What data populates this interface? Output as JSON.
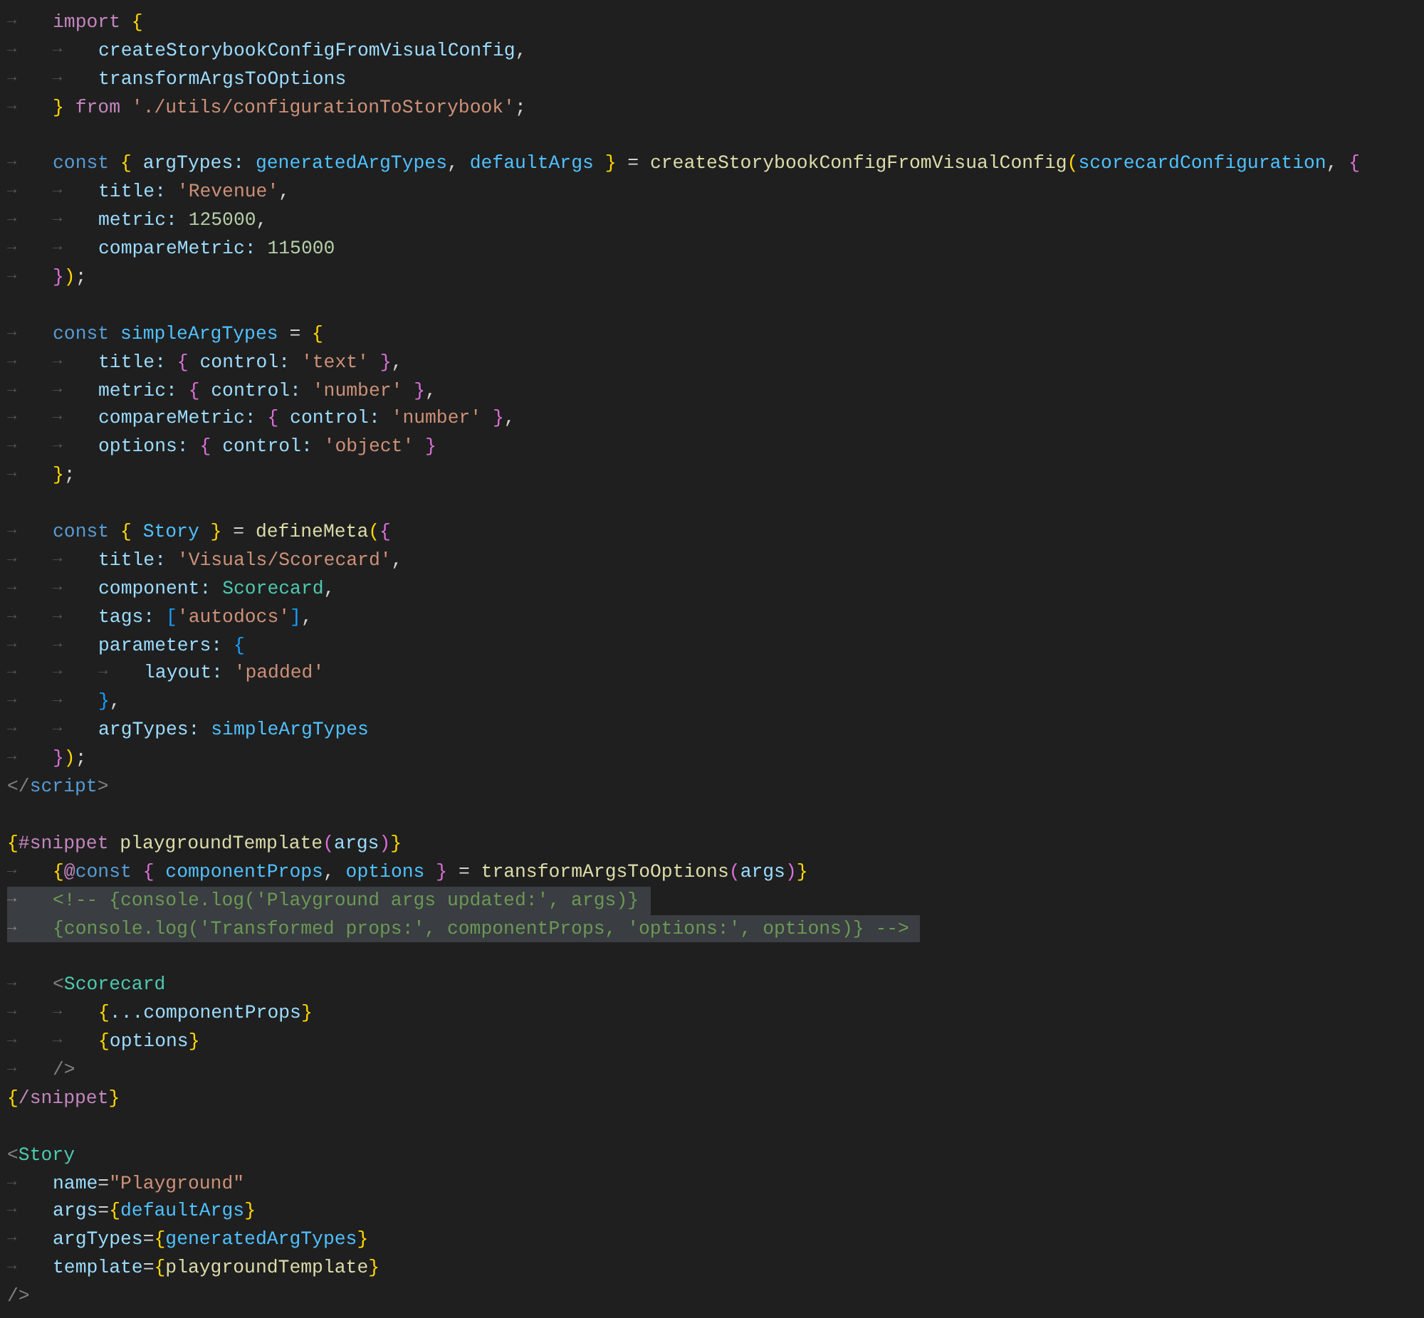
{
  "editor": {
    "lines": [
      {
        "tabs": [
          "→"
        ],
        "highlighted": false,
        "tokens": [
          {
            "text": "import",
            "color": "#c586c0"
          },
          {
            "text": " {",
            "color": "#ffd700"
          }
        ]
      },
      {
        "tabs": [
          "→",
          "→"
        ],
        "highlighted": false,
        "tokens": [
          {
            "text": "createStorybookConfigFromVisualConfig",
            "color": "#9cdcfe"
          },
          {
            "text": ",",
            "color": "#d4d4d4"
          }
        ]
      },
      {
        "tabs": [
          "→",
          "→"
        ],
        "highlighted": false,
        "tokens": [
          {
            "text": "transformArgsToOptions",
            "color": "#9cdcfe"
          }
        ]
      },
      {
        "tabs": [
          "→"
        ],
        "highlighted": false,
        "tokens": [
          {
            "text": "}",
            "color": "#ffd700"
          },
          {
            "text": " from ",
            "color": "#c586c0"
          },
          {
            "text": "'./utils/configurationToStorybook'",
            "color": "#ce9178"
          },
          {
            "text": ";",
            "color": "#d4d4d4"
          }
        ]
      },
      {
        "highlighted": false
      },
      {
        "tabs": [
          "→"
        ],
        "highlighted": false,
        "tokens": [
          {
            "text": "const",
            "color": "#569cd6"
          },
          {
            "text": " {",
            "color": "#ffd700"
          },
          {
            "text": " argTypes: ",
            "color": "#9cdcfe"
          },
          {
            "text": "generatedArgTypes",
            "color": "#4fc1ff"
          },
          {
            "text": ", ",
            "color": "#d4d4d4"
          },
          {
            "text": "defaultArgs",
            "color": "#4fc1ff"
          },
          {
            "text": " }",
            "color": "#ffd700"
          },
          {
            "text": " = ",
            "color": "#d4d4d4"
          },
          {
            "text": "createStorybookConfigFromVisualConfig",
            "color": "#dcdcaa"
          },
          {
            "text": "(",
            "color": "#ffd700"
          },
          {
            "text": "scorecardConfiguration",
            "color": "#4fc1ff"
          },
          {
            "text": ", ",
            "color": "#d4d4d4"
          },
          {
            "text": "{",
            "color": "#da70d6"
          }
        ]
      },
      {
        "tabs": [
          "→",
          "→"
        ],
        "highlighted": false,
        "tokens": [
          {
            "text": "title: ",
            "color": "#9cdcfe"
          },
          {
            "text": "'Revenue'",
            "color": "#ce9178"
          },
          {
            "text": ",",
            "color": "#d4d4d4"
          }
        ]
      },
      {
        "tabs": [
          "→",
          "→"
        ],
        "highlighted": false,
        "tokens": [
          {
            "text": "metric: ",
            "color": "#9cdcfe"
          },
          {
            "text": "125000",
            "color": "#b5cea8"
          },
          {
            "text": ",",
            "color": "#d4d4d4"
          }
        ]
      },
      {
        "tabs": [
          "→",
          "→"
        ],
        "highlighted": false,
        "tokens": [
          {
            "text": "compareMetric: ",
            "color": "#9cdcfe"
          },
          {
            "text": "115000",
            "color": "#b5cea8"
          }
        ]
      },
      {
        "tabs": [
          "→"
        ],
        "highlighted": false,
        "tokens": [
          {
            "text": "}",
            "color": "#da70d6"
          },
          {
            "text": ")",
            "color": "#ffd700"
          },
          {
            "text": ";",
            "color": "#d4d4d4"
          }
        ]
      },
      {
        "highlighted": false
      },
      {
        "tabs": [
          "→"
        ],
        "highlighted": false,
        "tokens": [
          {
            "text": "const",
            "color": "#569cd6"
          },
          {
            "text": " simpleArgTypes",
            "color": "#4fc1ff"
          },
          {
            "text": " = ",
            "color": "#d4d4d4"
          },
          {
            "text": "{",
            "color": "#ffd700"
          }
        ]
      },
      {
        "tabs": [
          "→",
          "→"
        ],
        "highlighted": false,
        "tokens": [
          {
            "text": "title: ",
            "color": "#9cdcfe"
          },
          {
            "text": "{",
            "color": "#da70d6"
          },
          {
            "text": " control: ",
            "color": "#9cdcfe"
          },
          {
            "text": "'text'",
            "color": "#ce9178"
          },
          {
            "text": " }",
            "color": "#da70d6"
          },
          {
            "text": ",",
            "color": "#d4d4d4"
          }
        ]
      },
      {
        "tabs": [
          "→",
          "→"
        ],
        "highlighted": false,
        "tokens": [
          {
            "text": "metric: ",
            "color": "#9cdcfe"
          },
          {
            "text": "{",
            "color": "#da70d6"
          },
          {
            "text": " control: ",
            "color": "#9cdcfe"
          },
          {
            "text": "'number'",
            "color": "#ce9178"
          },
          {
            "text": " }",
            "color": "#da70d6"
          },
          {
            "text": ",",
            "color": "#d4d4d4"
          }
        ]
      },
      {
        "tabs": [
          "→",
          "→"
        ],
        "highlighted": false,
        "tokens": [
          {
            "text": "compareMetric: ",
            "color": "#9cdcfe"
          },
          {
            "text": "{",
            "color": "#da70d6"
          },
          {
            "text": " control: ",
            "color": "#9cdcfe"
          },
          {
            "text": "'number'",
            "color": "#ce9178"
          },
          {
            "text": " }",
            "color": "#da70d6"
          },
          {
            "text": ",",
            "color": "#d4d4d4"
          }
        ]
      },
      {
        "tabs": [
          "→",
          "→"
        ],
        "highlighted": false,
        "tokens": [
          {
            "text": "options: ",
            "color": "#9cdcfe"
          },
          {
            "text": "{",
            "color": "#da70d6"
          },
          {
            "text": " control: ",
            "color": "#9cdcfe"
          },
          {
            "text": "'object'",
            "color": "#ce9178"
          },
          {
            "text": " }",
            "color": "#da70d6"
          }
        ]
      },
      {
        "tabs": [
          "→"
        ],
        "highlighted": false,
        "tokens": [
          {
            "text": "}",
            "color": "#ffd700"
          },
          {
            "text": ";",
            "color": "#d4d4d4"
          }
        ]
      },
      {
        "highlighted": false
      },
      {
        "tabs": [
          "→"
        ],
        "highlighted": false,
        "tokens": [
          {
            "text": "const",
            "color": "#569cd6"
          },
          {
            "text": " {",
            "color": "#ffd700"
          },
          {
            "text": " Story",
            "color": "#4fc1ff"
          },
          {
            "text": " }",
            "color": "#ffd700"
          },
          {
            "text": " = ",
            "color": "#d4d4d4"
          },
          {
            "text": "defineMeta",
            "color": "#dcdcaa"
          },
          {
            "text": "(",
            "color": "#ffd700"
          },
          {
            "text": "{",
            "color": "#da70d6"
          }
        ]
      },
      {
        "tabs": [
          "→",
          "→"
        ],
        "highlighted": false,
        "tokens": [
          {
            "text": "title: ",
            "color": "#9cdcfe"
          },
          {
            "text": "'Visuals/Scorecard'",
            "color": "#ce9178"
          },
          {
            "text": ",",
            "color": "#d4d4d4"
          }
        ]
      },
      {
        "tabs": [
          "→",
          "→"
        ],
        "highlighted": false,
        "tokens": [
          {
            "text": "component: ",
            "color": "#9cdcfe"
          },
          {
            "text": "Scorecard",
            "color": "#4ec9b0"
          },
          {
            "text": ",",
            "color": "#d4d4d4"
          }
        ]
      },
      {
        "tabs": [
          "→",
          "→"
        ],
        "highlighted": false,
        "tokens": [
          {
            "text": "tags: ",
            "color": "#9cdcfe"
          },
          {
            "text": "[",
            "color": "#179fff"
          },
          {
            "text": "'autodocs'",
            "color": "#ce9178"
          },
          {
            "text": "]",
            "color": "#179fff"
          },
          {
            "text": ",",
            "color": "#d4d4d4"
          }
        ]
      },
      {
        "tabs": [
          "→",
          "→"
        ],
        "highlighted": false,
        "tokens": [
          {
            "text": "parameters: ",
            "color": "#9cdcfe"
          },
          {
            "text": "{",
            "color": "#179fff"
          }
        ]
      },
      {
        "tabs": [
          "→",
          "→",
          "→"
        ],
        "highlighted": false,
        "tokens": [
          {
            "text": "layout: ",
            "color": "#9cdcfe"
          },
          {
            "text": "'padded'",
            "color": "#ce9178"
          }
        ]
      },
      {
        "tabs": [
          "→",
          "→"
        ],
        "highlighted": false,
        "tokens": [
          {
            "text": "}",
            "color": "#179fff"
          },
          {
            "text": ",",
            "color": "#d4d4d4"
          }
        ]
      },
      {
        "tabs": [
          "→",
          "→"
        ],
        "highlighted": false,
        "tokens": [
          {
            "text": "argTypes: ",
            "color": "#9cdcfe"
          },
          {
            "text": "simpleArgTypes",
            "color": "#4fc1ff"
          }
        ]
      },
      {
        "tabs": [
          "→"
        ],
        "highlighted": false,
        "tokens": [
          {
            "text": "}",
            "color": "#da70d6"
          },
          {
            "text": ")",
            "color": "#ffd700"
          },
          {
            "text": ";",
            "color": "#d4d4d4"
          }
        ]
      },
      {
        "highlighted": false,
        "tokens": [
          {
            "text": "</",
            "color": "#808080"
          },
          {
            "text": "script",
            "color": "#569cd6"
          },
          {
            "text": ">",
            "color": "#808080"
          }
        ]
      },
      {
        "highlighted": false
      },
      {
        "highlighted": false,
        "tokens": [
          {
            "text": "{",
            "color": "#ffd700"
          },
          {
            "text": "#snippet",
            "color": "#c586c0"
          },
          {
            "text": " playgroundTemplate",
            "color": "#dcdcaa"
          },
          {
            "text": "(",
            "color": "#da70d6"
          },
          {
            "text": "args",
            "color": "#9cdcfe"
          },
          {
            "text": ")",
            "color": "#da70d6"
          },
          {
            "text": "}",
            "color": "#ffd700"
          }
        ]
      },
      {
        "tabs": [
          "→"
        ],
        "highlighted": false,
        "tokens": [
          {
            "text": "{",
            "color": "#ffd700"
          },
          {
            "text": "@",
            "color": "#c586c0"
          },
          {
            "text": "const",
            "color": "#569cd6"
          },
          {
            "text": " {",
            "color": "#da70d6"
          },
          {
            "text": " componentProps",
            "color": "#4fc1ff"
          },
          {
            "text": ", ",
            "color": "#d4d4d4"
          },
          {
            "text": "options",
            "color": "#4fc1ff"
          },
          {
            "text": " }",
            "color": "#da70d6"
          },
          {
            "text": " = ",
            "color": "#d4d4d4"
          },
          {
            "text": "transformArgsToOptions",
            "color": "#dcdcaa"
          },
          {
            "text": "(",
            "color": "#da70d6"
          },
          {
            "text": "args",
            "color": "#9cdcfe"
          },
          {
            "text": ")",
            "color": "#da70d6"
          },
          {
            "text": "}",
            "color": "#ffd700"
          }
        ]
      },
      {
        "tabs": [
          "→"
        ],
        "highlighted": true,
        "tokens": [
          {
            "text": "<!-- {console.log('Playground args updated:', args)}",
            "color": "#6a9955"
          }
        ]
      },
      {
        "tabs": [
          "→"
        ],
        "highlighted": true,
        "tokens": [
          {
            "text": "{console.log('Transformed props:', componentProps, 'options:', options)} -->",
            "color": "#6a9955"
          }
        ]
      },
      {
        "highlighted": false
      },
      {
        "tabs": [
          "→"
        ],
        "highlighted": false,
        "tokens": [
          {
            "text": "<",
            "color": "#808080"
          },
          {
            "text": "Scorecard",
            "color": "#4ec9b0"
          }
        ]
      },
      {
        "tabs": [
          "→",
          "→"
        ],
        "highlighted": false,
        "tokens": [
          {
            "text": "{",
            "color": "#ffd700"
          },
          {
            "text": "...componentProps",
            "color": "#9cdcfe"
          },
          {
            "text": "}",
            "color": "#ffd700"
          }
        ]
      },
      {
        "tabs": [
          "→",
          "→"
        ],
        "highlighted": false,
        "tokens": [
          {
            "text": "{",
            "color": "#ffd700"
          },
          {
            "text": "options",
            "color": "#9cdcfe"
          },
          {
            "text": "}",
            "color": "#ffd700"
          }
        ]
      },
      {
        "tabs": [
          "→"
        ],
        "highlighted": false,
        "tokens": [
          {
            "text": "/>",
            "color": "#808080"
          }
        ]
      },
      {
        "highlighted": false,
        "tokens": [
          {
            "text": "{",
            "color": "#ffd700"
          },
          {
            "text": "/snippet",
            "color": "#c586c0"
          },
          {
            "text": "}",
            "color": "#ffd700"
          }
        ]
      },
      {
        "highlighted": false
      },
      {
        "highlighted": false,
        "tokens": [
          {
            "text": "<",
            "color": "#808080"
          },
          {
            "text": "Story",
            "color": "#4ec9b0"
          }
        ]
      },
      {
        "tabs": [
          "→"
        ],
        "highlighted": false,
        "tokens": [
          {
            "text": "name",
            "color": "#9cdcfe"
          },
          {
            "text": "=",
            "color": "#d4d4d4"
          },
          {
            "text": "\"Playground\"",
            "color": "#ce9178"
          }
        ]
      },
      {
        "tabs": [
          "→"
        ],
        "highlighted": false,
        "tokens": [
          {
            "text": "args",
            "color": "#9cdcfe"
          },
          {
            "text": "=",
            "color": "#d4d4d4"
          },
          {
            "text": "{",
            "color": "#ffd700"
          },
          {
            "text": "defaultArgs",
            "color": "#4fc1ff"
          },
          {
            "text": "}",
            "color": "#ffd700"
          }
        ]
      },
      {
        "tabs": [
          "→"
        ],
        "highlighted": false,
        "tokens": [
          {
            "text": "argTypes",
            "color": "#9cdcfe"
          },
          {
            "text": "=",
            "color": "#d4d4d4"
          },
          {
            "text": "{",
            "color": "#ffd700"
          },
          {
            "text": "generatedArgTypes",
            "color": "#4fc1ff"
          },
          {
            "text": "}",
            "color": "#ffd700"
          }
        ]
      },
      {
        "tabs": [
          "→"
        ],
        "highlighted": false,
        "tokens": [
          {
            "text": "template",
            "color": "#9cdcfe"
          },
          {
            "text": "=",
            "color": "#d4d4d4"
          },
          {
            "text": "{",
            "color": "#ffd700"
          },
          {
            "text": "playgroundTemplate",
            "color": "#dcdcaa"
          },
          {
            "text": "}",
            "color": "#ffd700"
          }
        ]
      },
      {
        "highlighted": false,
        "tokens": [
          {
            "text": "/>",
            "color": "#808080"
          }
        ]
      }
    ]
  }
}
